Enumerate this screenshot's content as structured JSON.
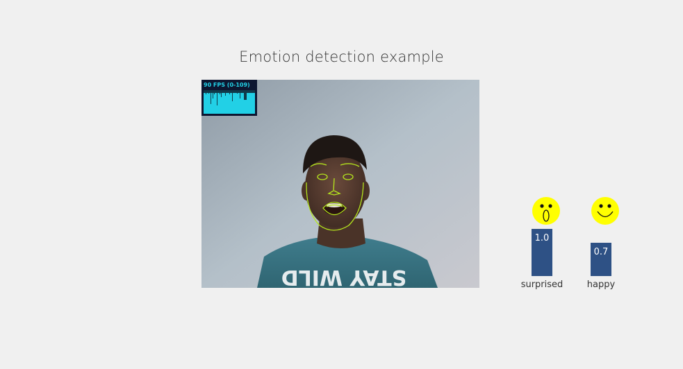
{
  "page": {
    "title": "Emotion detection example"
  },
  "video": {
    "fps_label": "90 FPS (0-109)",
    "fps_color": "#22d0e6",
    "panel_color": "#0d1631",
    "overlay_color": "#b5e61d",
    "shirt_text": "STAY WILD"
  },
  "emotions": [
    {
      "name": "surprised",
      "value": "1.0",
      "score": 1.0,
      "emoji": "surprised-face-icon"
    },
    {
      "name": "happy",
      "value": "0.7",
      "score": 0.7,
      "emoji": "smiling-face-icon"
    }
  ],
  "colors": {
    "bar": "#2e5185",
    "emoji": "#ffff00",
    "background": "#f0f0f0"
  }
}
